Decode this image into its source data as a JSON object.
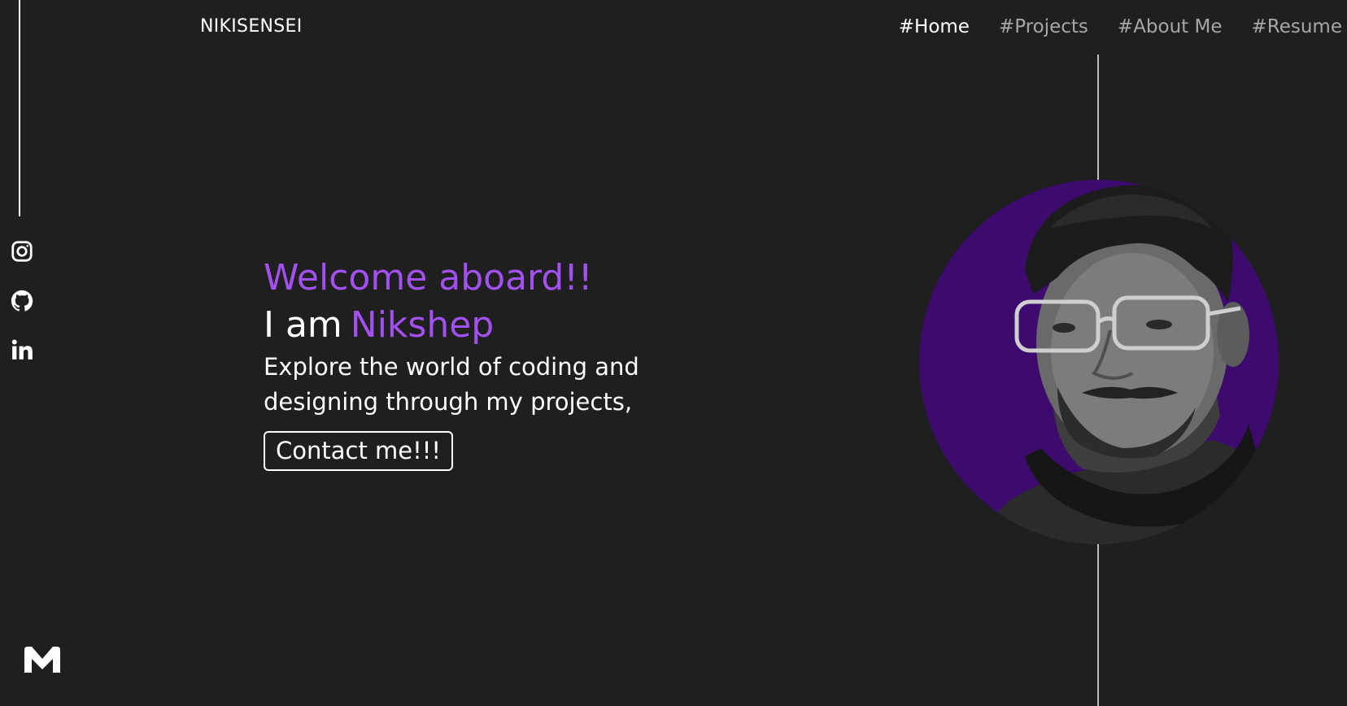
{
  "header": {
    "brand": "NIKISENSEI",
    "nav": [
      {
        "label": "#Home",
        "active": true
      },
      {
        "label": "#Projects",
        "active": false
      },
      {
        "label": "#About Me",
        "active": false
      },
      {
        "label": "#Resume",
        "active": false
      }
    ]
  },
  "social": [
    {
      "icon": "instagram-icon"
    },
    {
      "icon": "github-icon"
    },
    {
      "icon": "linkedin-icon"
    }
  ],
  "hero": {
    "welcome": "Welcome aboard!!",
    "iam_prefix": "I am",
    "name": "Nikshep",
    "tagline": "Explore the world of coding and designing through my projects,",
    "contact_label": "Contact me!!!"
  },
  "logo": {
    "icon": "m-logo-icon"
  },
  "colors": {
    "background": "#1f1f1f",
    "accent": "#a350f0",
    "portrait_bg": "#3d0a6e",
    "nav_inactive": "#a7a7a7"
  }
}
